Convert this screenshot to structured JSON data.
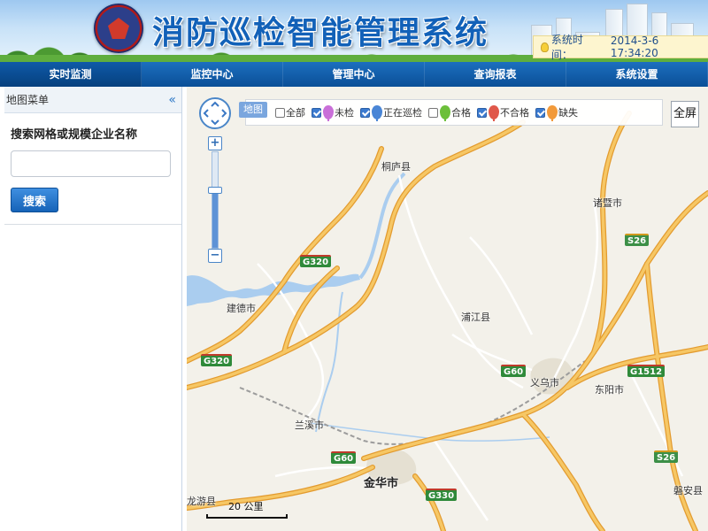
{
  "app": {
    "title": "消防巡检智能管理系统",
    "system_time_label": "系统时间：",
    "system_time_value": "2014-3-6 17:34:20"
  },
  "nav": {
    "tabs": [
      {
        "label": "实时监测",
        "active": true
      },
      {
        "label": "监控中心",
        "active": false
      },
      {
        "label": "管理中心",
        "active": false
      },
      {
        "label": "查询报表",
        "active": false
      },
      {
        "label": "系统设置",
        "active": false
      }
    ]
  },
  "sidebar": {
    "title": "地图菜单",
    "collapse_glyph": "«",
    "search_label": "搜索网格或规模企业名称",
    "search_value": "",
    "search_button": "搜索"
  },
  "map": {
    "map_type_label": "地图",
    "fullscreen_label": "全屏",
    "scale_label": "20 公里",
    "zoom_level_fraction": 0.6,
    "legend": [
      {
        "label": "全部",
        "checked": false,
        "color": null
      },
      {
        "label": "未检",
        "checked": true,
        "color": "#c96fd8"
      },
      {
        "label": "正在巡检",
        "checked": true,
        "color": "#4a86d6"
      },
      {
        "label": "合格",
        "checked": false,
        "color": "#6cbf3a"
      },
      {
        "label": "不合格",
        "checked": true,
        "color": "#e0584a"
      },
      {
        "label": "缺失",
        "checked": true,
        "color": "#f29a3a"
      }
    ],
    "places": [
      {
        "name": "桐庐县",
        "big": false
      },
      {
        "name": "诸暨市",
        "big": false
      },
      {
        "name": "建德市",
        "big": false
      },
      {
        "name": "浦江县",
        "big": false
      },
      {
        "name": "义乌市",
        "big": false
      },
      {
        "name": "东阳市",
        "big": false
      },
      {
        "name": "兰溪市",
        "big": false
      },
      {
        "name": "金华市",
        "big": true
      },
      {
        "name": "龙游县",
        "big": false
      },
      {
        "name": "磐安县",
        "big": false
      }
    ],
    "road_shields": [
      "G320",
      "G320",
      "S26",
      "G60",
      "G1512",
      "G60",
      "G330",
      "S26"
    ]
  },
  "colors": {
    "nav_bg": "#0b4f97",
    "title_blue": "#1261b8",
    "road_major": "#f6b74e",
    "water": "#aacdef"
  }
}
